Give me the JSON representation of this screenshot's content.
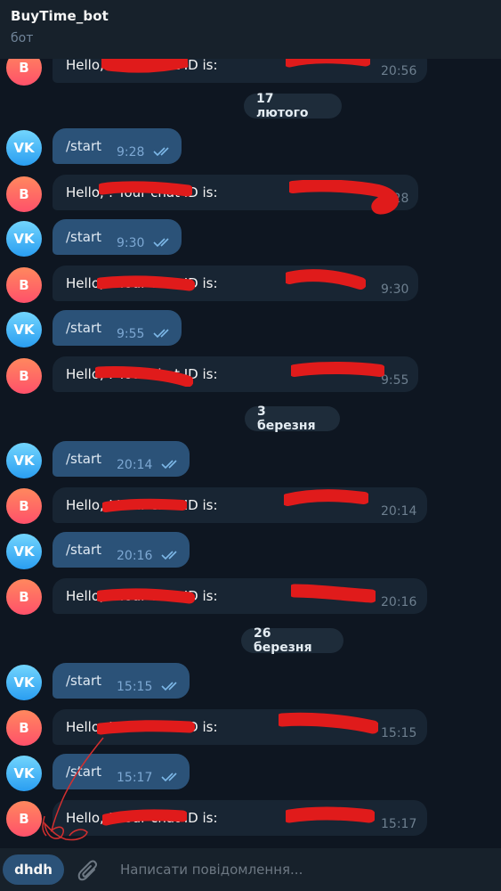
{
  "header": {
    "title": "BuyTime_bot",
    "subtitle": "бот"
  },
  "avatars": {
    "user": "VK",
    "bot": "B"
  },
  "dates": [
    "17 лютого",
    "3 березня",
    "26 березня"
  ],
  "messages": [
    {
      "text": "Hello,                    ! Your chat ID is:                  ",
      "time": "20:56"
    },
    {
      "text": "/start",
      "time": "9:28"
    },
    {
      "text": "Hello,                      ! Your chat ID is:                      ",
      "time": "9:28"
    },
    {
      "text": "/start",
      "time": "9:30"
    },
    {
      "text": "Hello,                      ! Your chat ID is:                  ",
      "time": "9:30"
    },
    {
      "text": "/start",
      "time": "9:55"
    },
    {
      "text": "Hello,                      ! Your chat ID is:                  ",
      "time": "9:55"
    },
    {
      "text": "/start",
      "time": "20:14"
    },
    {
      "text": "Hello,                    ! Your chat ID is:                  ",
      "time": "20:14"
    },
    {
      "text": "/start",
      "time": "20:16"
    },
    {
      "text": "Hello,                      ! Your chat ID is:                  ",
      "time": "20:16"
    },
    {
      "text": "/start",
      "time": "15:15"
    },
    {
      "text": "Hello,                      ! Your chat ID is:                  ",
      "time": "15:15"
    },
    {
      "text": "/start",
      "time": "15:17"
    },
    {
      "text": "Hello,                    ! Your chat ID is:                  ",
      "time": "15:17"
    }
  ],
  "composer": {
    "keyboard_button": "dhdh",
    "placeholder": "Написати повідомлення..."
  },
  "colors": {
    "background": "#0e1621",
    "outgoing_bubble": "#2b5278",
    "incoming_bubble": "#182533",
    "redaction": "#e01b1b"
  }
}
